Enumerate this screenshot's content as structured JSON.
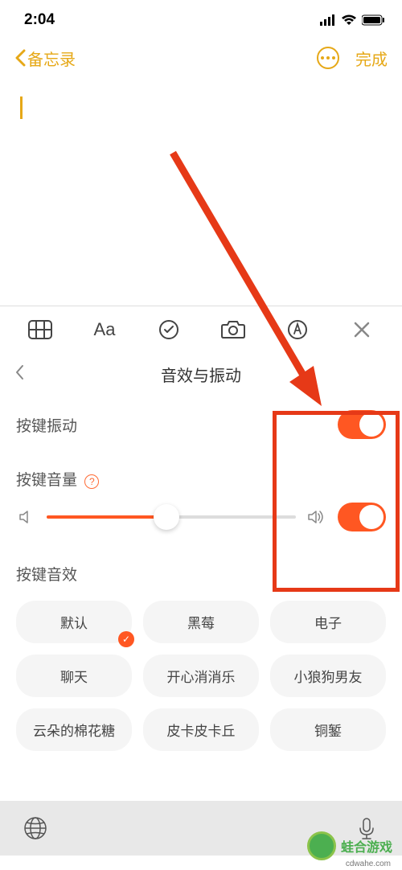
{
  "status": {
    "time": "2:04"
  },
  "nav": {
    "back_label": "备忘录",
    "done_label": "完成"
  },
  "toolbar": {
    "format_label": "Aa"
  },
  "panel": {
    "title": "音效与振动"
  },
  "settings": {
    "vibration_label": "按键振动",
    "volume_label": "按键音量",
    "sound_effect_label": "按键音效"
  },
  "sound_chips": [
    "默认",
    "黑莓",
    "电子",
    "聊天",
    "开心消消乐",
    "小狼狗男友",
    "云朵的棉花糖",
    "皮卡皮卡丘",
    "铜錾"
  ],
  "slider": {
    "value": 48
  },
  "watermark": {
    "text": "蛙合游戏",
    "url": "cdwahe.com"
  }
}
